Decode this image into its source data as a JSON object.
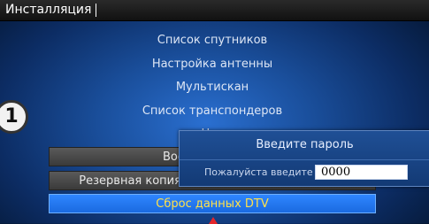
{
  "window": {
    "title": "Инсталляция"
  },
  "menu": {
    "items": [
      {
        "label": "Список спутников"
      },
      {
        "label": "Настройка антенны"
      },
      {
        "label": "Мультискан"
      },
      {
        "label": "Список транспондеров"
      },
      {
        "label": "Нас"
      },
      {
        "label": "Восстановление"
      },
      {
        "label": "Резервная копия пользовательских данных"
      },
      {
        "label": "Сброс данных DTV"
      }
    ],
    "selected_index": 7
  },
  "badge": {
    "number": "1"
  },
  "dialog": {
    "title": "Введите пароль",
    "prompt": "Пожалуйста введите",
    "value": "0000"
  },
  "colors": {
    "selected_text": "#ffe14a",
    "selection_bg": "#1a6ae0",
    "pointer_arrow": "#e4262b"
  }
}
